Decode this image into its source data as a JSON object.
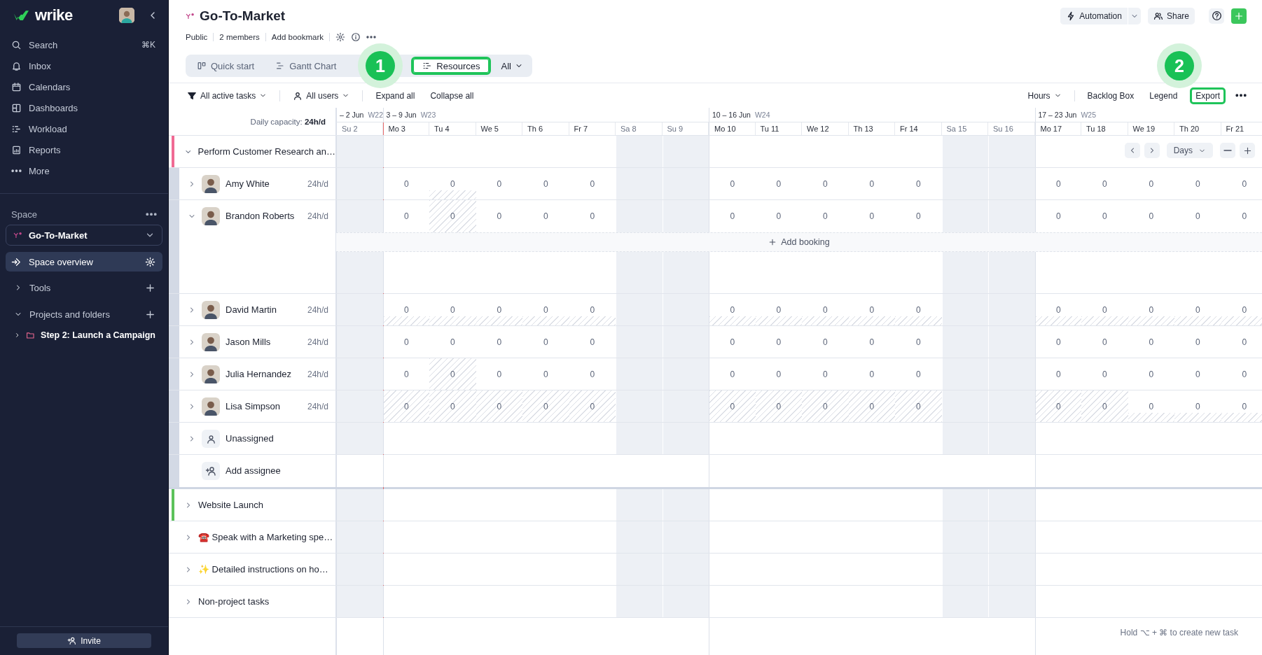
{
  "sidebar": {
    "brand": "wrike",
    "nav": [
      {
        "label": "Search",
        "shortcut": "⌘K",
        "selected": false
      },
      {
        "label": "Inbox",
        "selected": false
      },
      {
        "label": "Calendars",
        "selected": false
      },
      {
        "label": "Dashboards",
        "selected": false
      },
      {
        "label": "Workload",
        "selected": false
      },
      {
        "label": "Reports",
        "selected": false
      },
      {
        "label": "More",
        "selected": false
      }
    ],
    "space": {
      "label": "Space",
      "current": "Go-To-Market",
      "items": [
        {
          "label": "Space overview",
          "selected": true
        }
      ],
      "sections": [
        {
          "label": "Tools",
          "expanded": false
        },
        {
          "label": "Projects and folders",
          "expanded": true,
          "children": [
            {
              "label": "Step 2: Launch a Campaign",
              "expanded": false
            }
          ]
        }
      ]
    },
    "invite": "Invite"
  },
  "header": {
    "title": "Go-To-Market",
    "meta": [
      "Public",
      "2 members",
      "Add bookmark"
    ],
    "actions": [
      {
        "label": "Automation"
      },
      {
        "label": "Share"
      }
    ],
    "tabs": [
      {
        "label": "Quick start",
        "selected": false,
        "highlighted": false
      },
      {
        "label": "Gantt Chart",
        "selected": false,
        "highlighted": false
      },
      {
        "label": "Resources",
        "selected": true,
        "highlighted": true
      }
    ],
    "view_menu": "All"
  },
  "annotations": [
    {
      "number": "1"
    },
    {
      "number": "2"
    }
  ],
  "toolbar": {
    "filters": [
      {
        "label": "All active tasks"
      },
      {
        "label": "All users"
      }
    ],
    "actions": [
      "Expand all",
      "Collapse all"
    ],
    "unit": "Hours",
    "right_actions": [
      {
        "label": "Backlog Box",
        "highlighted": false
      },
      {
        "label": "Legend",
        "highlighted": false
      },
      {
        "label": "Export",
        "highlighted": true
      }
    ]
  },
  "timeline": {
    "capacity": "Daily capacity: **24h/d**",
    "scale": "Days",
    "weeks": [
      {
        "range": "– 2 Jun",
        "week": "W22",
        "days": [
          {
            "label": "Su 2",
            "weekend": true,
            "today": false
          }
        ]
      },
      {
        "range": "3 – 9 Jun",
        "week": "W23",
        "days": [
          {
            "label": "Mo 3",
            "weekend": false,
            "today": true
          },
          {
            "label": "Tu 4",
            "weekend": false,
            "today": false
          },
          {
            "label": "We 5",
            "weekend": false,
            "today": false
          },
          {
            "label": "Th 6",
            "weekend": false,
            "today": false
          },
          {
            "label": "Fr 7",
            "weekend": false,
            "today": false
          },
          {
            "label": "Sa 8",
            "weekend": true,
            "today": false
          },
          {
            "label": "Su 9",
            "weekend": true,
            "today": false
          }
        ]
      },
      {
        "range": "10 – 16 Jun",
        "week": "W24",
        "days": [
          {
            "label": "Mo 10",
            "weekend": false,
            "today": false
          },
          {
            "label": "Tu 11",
            "weekend": false,
            "today": false
          },
          {
            "label": "We 12",
            "weekend": false,
            "today": false
          },
          {
            "label": "Th 13",
            "weekend": false,
            "today": false
          },
          {
            "label": "Fr 14",
            "weekend": false,
            "today": false
          },
          {
            "label": "Sa 15",
            "weekend": true,
            "today": false
          },
          {
            "label": "Su 16",
            "weekend": true,
            "today": false
          }
        ]
      },
      {
        "range": "17 – 23 Jun",
        "week": "W25",
        "days": [
          {
            "label": "Mo 17",
            "weekend": false,
            "today": false
          },
          {
            "label": "Tu 18",
            "weekend": false,
            "today": false
          },
          {
            "label": "We 19",
            "weekend": false,
            "today": false
          },
          {
            "label": "Th 20",
            "weekend": false,
            "today": false
          },
          {
            "label": "Fr 21",
            "weekend": false,
            "today": false
          }
        ]
      }
    ]
  },
  "groups": [
    {
      "title": "Perform Customer Research an…",
      "color": "#f06a93",
      "expanded": true,
      "members": [
        {
          "name": "Amy White",
          "capacity": "24h/d",
          "expanded": false,
          "cells": [
            {
              "value": "0",
              "kind": "plain"
            },
            {
              "value": "0",
              "kind": "partial"
            },
            {
              "value": "0",
              "kind": "plain"
            },
            {
              "value": "0",
              "kind": "plain"
            },
            {
              "value": "0",
              "kind": "plain"
            },
            {
              "value": "0",
              "kind": "plain"
            },
            {
              "value": "0",
              "kind": "plain"
            },
            {
              "value": "0",
              "kind": "plain"
            },
            {
              "value": "0",
              "kind": "plain"
            },
            {
              "value": "0",
              "kind": "plain"
            },
            {
              "value": "0",
              "kind": "plain"
            },
            {
              "value": "0",
              "kind": "plain"
            },
            {
              "value": "0",
              "kind": "plain"
            },
            {
              "value": "0",
              "kind": "plain"
            },
            {
              "value": "0",
              "kind": "plain"
            }
          ]
        },
        {
          "name": "Brandon Roberts",
          "capacity": "24h/d",
          "expanded": true,
          "add_booking": "Add booking",
          "cells": [
            {
              "value": "0",
              "kind": "plain"
            },
            {
              "value": "0",
              "kind": "hatched"
            },
            {
              "value": "0",
              "kind": "plain"
            },
            {
              "value": "0",
              "kind": "plain"
            },
            {
              "value": "0",
              "kind": "plain"
            },
            {
              "value": "0",
              "kind": "plain"
            },
            {
              "value": "0",
              "kind": "plain"
            },
            {
              "value": "0",
              "kind": "plain"
            },
            {
              "value": "0",
              "kind": "plain"
            },
            {
              "value": "0",
              "kind": "plain"
            },
            {
              "value": "0",
              "kind": "plain"
            },
            {
              "value": "0",
              "kind": "plain"
            },
            {
              "value": "0",
              "kind": "plain"
            },
            {
              "value": "0",
              "kind": "plain"
            },
            {
              "value": "0",
              "kind": "plain"
            }
          ]
        },
        {
          "name": "David Martin",
          "capacity": "24h/d",
          "expanded": false,
          "cells": [
            {
              "value": "0",
              "kind": "partial"
            },
            {
              "value": "0",
              "kind": "partial"
            },
            {
              "value": "0",
              "kind": "partial"
            },
            {
              "value": "0",
              "kind": "partial"
            },
            {
              "value": "0",
              "kind": "partial"
            },
            {
              "value": "0",
              "kind": "partial"
            },
            {
              "value": "0",
              "kind": "partial"
            },
            {
              "value": "0",
              "kind": "partial"
            },
            {
              "value": "0",
              "kind": "partial"
            },
            {
              "value": "0",
              "kind": "partial"
            },
            {
              "value": "0",
              "kind": "partial"
            },
            {
              "value": "0",
              "kind": "partial"
            },
            {
              "value": "0",
              "kind": "partial"
            },
            {
              "value": "0",
              "kind": "partial"
            },
            {
              "value": "0",
              "kind": "partial"
            }
          ]
        },
        {
          "name": "Jason Mills",
          "capacity": "24h/d",
          "expanded": false,
          "cells": [
            {
              "value": "0",
              "kind": "plain"
            },
            {
              "value": "0",
              "kind": "plain"
            },
            {
              "value": "0",
              "kind": "plain"
            },
            {
              "value": "0",
              "kind": "plain"
            },
            {
              "value": "0",
              "kind": "plain"
            },
            {
              "value": "0",
              "kind": "plain"
            },
            {
              "value": "0",
              "kind": "plain"
            },
            {
              "value": "0",
              "kind": "plain"
            },
            {
              "value": "0",
              "kind": "plain"
            },
            {
              "value": "0",
              "kind": "plain"
            },
            {
              "value": "0",
              "kind": "plain"
            },
            {
              "value": "0",
              "kind": "plain"
            },
            {
              "value": "0",
              "kind": "plain"
            },
            {
              "value": "0",
              "kind": "plain"
            },
            {
              "value": "0",
              "kind": "plain"
            }
          ]
        },
        {
          "name": "Julia Hernandez",
          "capacity": "24h/d",
          "expanded": false,
          "cells": [
            {
              "value": "0",
              "kind": "plain"
            },
            {
              "value": "0",
              "kind": "hatched"
            },
            {
              "value": "0",
              "kind": "plain"
            },
            {
              "value": "0",
              "kind": "plain"
            },
            {
              "value": "0",
              "kind": "plain"
            },
            {
              "value": "0",
              "kind": "plain"
            },
            {
              "value": "0",
              "kind": "plain"
            },
            {
              "value": "0",
              "kind": "plain"
            },
            {
              "value": "0",
              "kind": "plain"
            },
            {
              "value": "0",
              "kind": "plain"
            },
            {
              "value": "0",
              "kind": "plain"
            },
            {
              "value": "0",
              "kind": "plain"
            },
            {
              "value": "0",
              "kind": "plain"
            },
            {
              "value": "0",
              "kind": "plain"
            },
            {
              "value": "0",
              "kind": "plain"
            }
          ]
        },
        {
          "name": "Lisa Simpson",
          "capacity": "24h/d",
          "expanded": false,
          "cells": [
            {
              "value": "0",
              "kind": "hatched"
            },
            {
              "value": "0",
              "kind": "hatched"
            },
            {
              "value": "0",
              "kind": "hatched"
            },
            {
              "value": "0",
              "kind": "hatched"
            },
            {
              "value": "0",
              "kind": "hatched"
            },
            {
              "value": "0",
              "kind": "hatched"
            },
            {
              "value": "0",
              "kind": "hatched"
            },
            {
              "value": "0",
              "kind": "hatched"
            },
            {
              "value": "0",
              "kind": "hatched"
            },
            {
              "value": "0",
              "kind": "hatched"
            },
            {
              "value": "0",
              "kind": "hatched"
            },
            {
              "value": "0",
              "kind": "hatched"
            },
            {
              "value": "0",
              "kind": "partial"
            },
            {
              "value": "0",
              "kind": "partial"
            },
            {
              "value": "0",
              "kind": "partial"
            }
          ]
        }
      ],
      "unassigned": {
        "label": "Unassigned",
        "expanded": false
      },
      "add_assignee": "Add assignee"
    },
    {
      "title": "Website Launch",
      "color": "#5cc25a",
      "expanded": false
    },
    {
      "title": "☎️ Speak with a Marketing spe…",
      "expanded": false
    },
    {
      "title": "✨ Detailed instructions on ho…",
      "expanded": false
    },
    {
      "title": "Non-project tasks",
      "expanded": false
    }
  ],
  "hint": "Hold ⌥ + ⌘ to create new task"
}
